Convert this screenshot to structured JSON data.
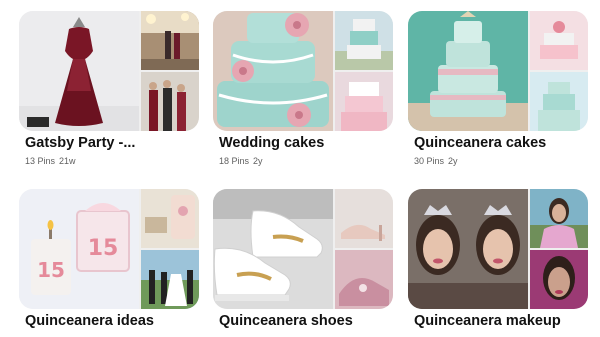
{
  "boards": [
    {
      "title": "Gatsby Party -...",
      "pins": "13 Pins",
      "age": "21w",
      "colors": {
        "main_bg": "#ececee",
        "accent": "#7a1626"
      }
    },
    {
      "title": "Wedding cakes",
      "pins": "18 Pins",
      "age": "2y",
      "colors": {
        "main_bg": "#dcc9be",
        "accent": "#9ed4cc"
      }
    },
    {
      "title": "Quinceanera cakes",
      "pins": "30 Pins",
      "age": "2y",
      "colors": {
        "main_bg": "#5fb5a6",
        "accent": "#bfe3db"
      }
    },
    {
      "title": "Quinceanera ideas",
      "pins": "",
      "age": "",
      "colors": {
        "main_bg": "#eef0f6",
        "accent": "#e58a9a"
      }
    },
    {
      "title": "Quinceanera shoes",
      "pins": "",
      "age": "",
      "colors": {
        "main_bg": "#dcdcdc",
        "accent": "#c8a052"
      }
    },
    {
      "title": "Quinceanera makeup",
      "pins": "",
      "age": "",
      "colors": {
        "main_bg": "#7a6f68",
        "accent": "#9b3a74"
      }
    }
  ]
}
